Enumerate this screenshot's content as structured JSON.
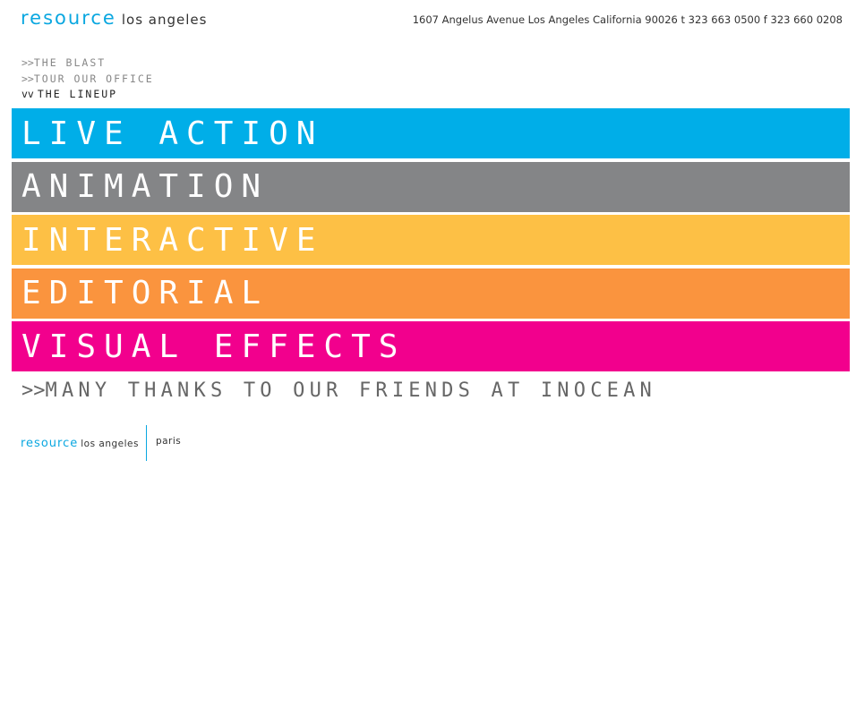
{
  "header": {
    "brand": "resource",
    "city": "los angeles",
    "address": "1607 Angelus Avenue Los Angeles California 90026  t 323 663 0500 f 323 660 0208"
  },
  "subnav": {
    "items": [
      {
        "arrow": ">>",
        "label": "THE BLAST"
      },
      {
        "arrow": ">>",
        "label": "TOUR OUR OFFICE"
      },
      {
        "arrow": "vv",
        "label": "THE LINEUP"
      }
    ]
  },
  "lineup": [
    {
      "label": "LIVE ACTION",
      "color": "#00aee8"
    },
    {
      "label": "ANIMATION",
      "color": "#848587"
    },
    {
      "label": "INTERACTIVE",
      "color": "#fdc045"
    },
    {
      "label": "EDITORIAL",
      "color": "#fa943e"
    },
    {
      "label": "VISUAL EFFECTS",
      "color": "#f2008d"
    }
  ],
  "thanks": {
    "arrow": ">>",
    "text": "MANY THANKS TO OUR FRIENDS AT INOCEAN"
  },
  "footer": {
    "brand": "resource",
    "city": "los angeles",
    "other_office": "paris"
  },
  "colors": {
    "accent": "#0aa7e0"
  }
}
